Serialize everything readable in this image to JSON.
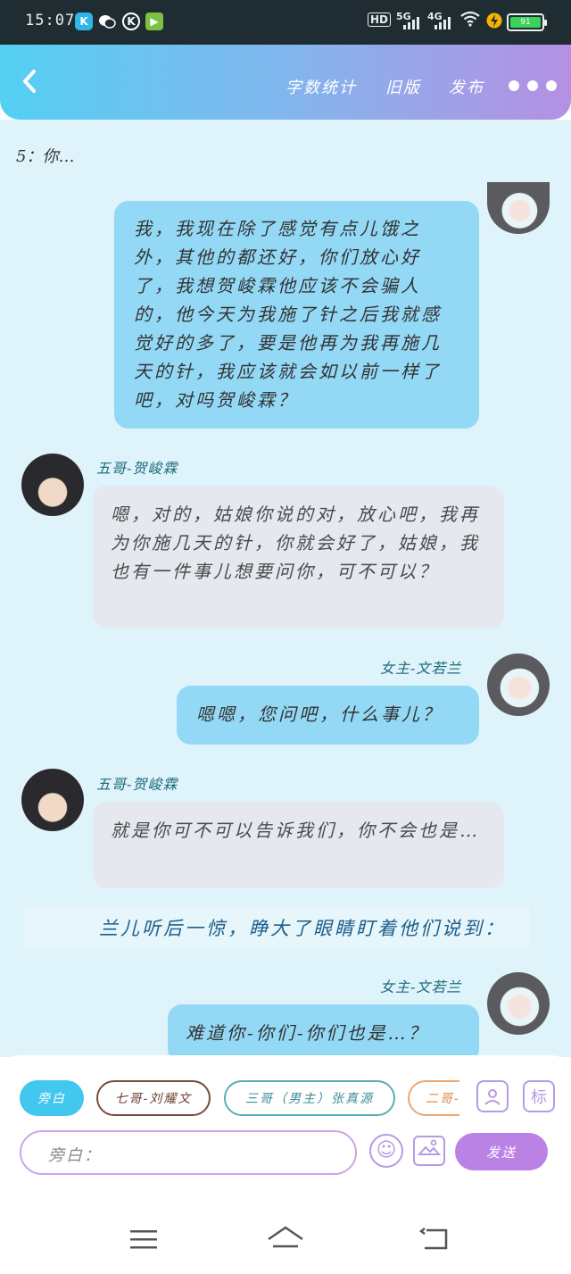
{
  "status_bar": {
    "time": "15:07",
    "signal_5g": "5G",
    "signal_4g": "4G",
    "hd_badge": "HD",
    "battery_level": "91"
  },
  "header": {
    "word_count": "字数统计",
    "old_version": "旧版",
    "publish": "发布"
  },
  "chat": {
    "intro": "5：你…",
    "messages": [
      {
        "side": "right",
        "speaker": "",
        "text": "我，我现在除了感觉有点儿饿之外，其他的都还好，你们放心好了，我想贺峻霖他应该不会骗人的，他今天为我施了针之后我就感觉好的多了，要是他再为我再施几天的针，我应该就会如以前一样了吧，对吗贺峻霖？"
      },
      {
        "side": "left",
        "speaker": "五哥-贺峻霖",
        "text": "嗯，对的，姑娘你说的对，放心吧，我再为你施几天的针，你就会好了，姑娘，我也有一件事儿想要问你，可不可以？"
      },
      {
        "side": "right",
        "speaker": "女主-文若兰",
        "text": "嗯嗯，您问吧，什么事儿？"
      },
      {
        "side": "left",
        "speaker": "五哥-贺峻霖",
        "text": "就是你可不可以告诉我们，你不会也是…"
      },
      {
        "side": "narration",
        "speaker": "",
        "text": "兰儿听后一惊，睁大了眼睛盯着他们说到："
      },
      {
        "side": "right",
        "speaker": "女主-文若兰",
        "text": "难道你-你们-你们也是…？"
      }
    ]
  },
  "composer": {
    "roles": [
      "旁白",
      "七哥-刘耀文",
      "三哥（男主）张真源",
      "二哥-"
    ],
    "input_placeholder": "旁白：",
    "send_label": "发送",
    "tag_icon_label": "标"
  }
}
